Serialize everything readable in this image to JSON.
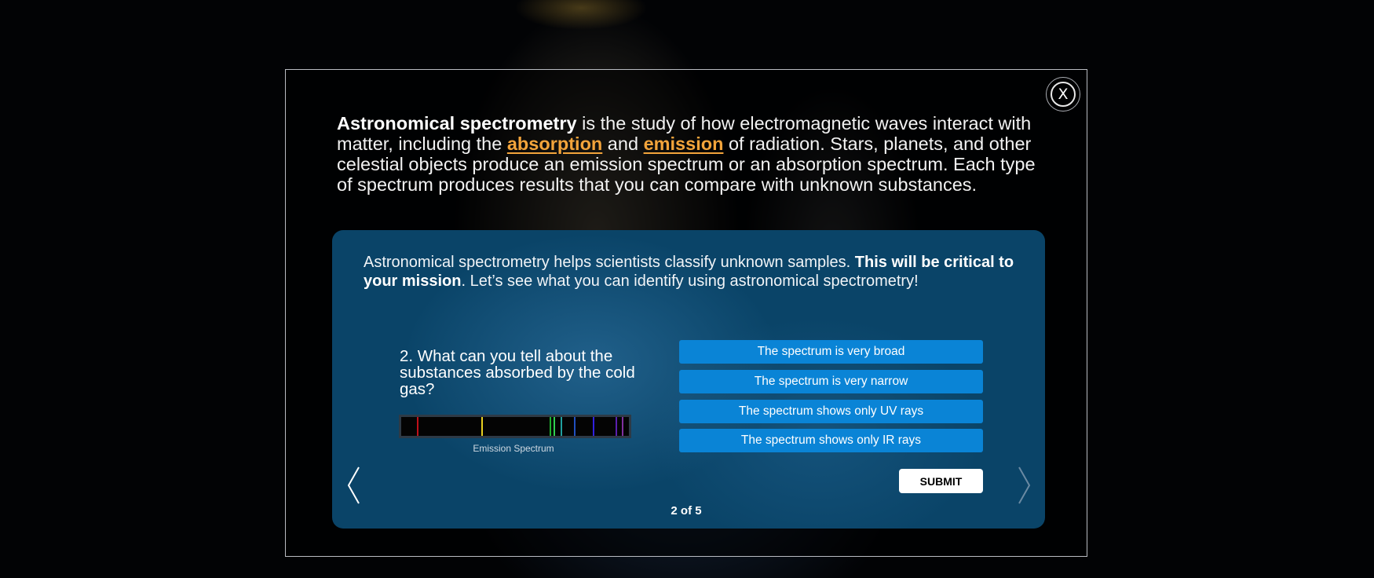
{
  "modal": {
    "close_label": "X",
    "intro": {
      "part1_bold": "Astronomical spectrometry",
      "part2": " is the study of how electromagnetic waves interact with matter, including the ",
      "term_absorption": "absorption",
      "part3": " and ",
      "term_emission": "emission",
      "part4": " of radiation. Stars, planets, and other celestial objects produce an emission spectrum or an absorption spectrum. Each type of spectrum produces results that you can compare with unknown substances."
    }
  },
  "panel": {
    "lead": {
      "part1": "Astronomical spectrometry helps scientists classify unknown samples. ",
      "part2_bold": "This will be critical to your mission",
      "part3": ". Let’s see what you can identify using astronomical spectrometry!"
    },
    "question": "2. What can you tell about the substances absorbed by  the cold gas?",
    "spectrum_caption": "Emission Spectrum",
    "spectrum_lines": [
      {
        "color": "#c0101a",
        "pos": 0.07
      },
      {
        "color": "#e8d020",
        "pos": 0.35
      },
      {
        "color": "#20b030",
        "pos": 0.65
      },
      {
        "color": "#30d050",
        "pos": 0.67
      },
      {
        "color": "#20a0a0",
        "pos": 0.7
      },
      {
        "color": "#2050c0",
        "pos": 0.76
      },
      {
        "color": "#3020e0",
        "pos": 0.84
      },
      {
        "color": "#5a20b0",
        "pos": 0.94
      },
      {
        "color": "#8030a0",
        "pos": 0.97
      }
    ],
    "answers": [
      "The spectrum is very broad",
      "The spectrum is very narrow",
      "The spectrum shows only UV rays",
      "The spectrum shows only IR rays"
    ],
    "submit_label": "SUBMIT",
    "pager": "2 of 5"
  },
  "colors": {
    "accent": "#0a84d6",
    "term": "#f3a43b",
    "panel": "#0a4468"
  }
}
